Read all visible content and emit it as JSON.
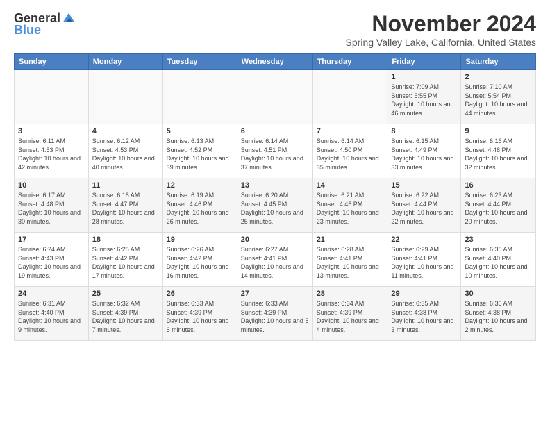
{
  "logo": {
    "general": "General",
    "blue": "Blue"
  },
  "title": "November 2024",
  "location": "Spring Valley Lake, California, United States",
  "days_header": [
    "Sunday",
    "Monday",
    "Tuesday",
    "Wednesday",
    "Thursday",
    "Friday",
    "Saturday"
  ],
  "weeks": [
    [
      {
        "day": "",
        "info": ""
      },
      {
        "day": "",
        "info": ""
      },
      {
        "day": "",
        "info": ""
      },
      {
        "day": "",
        "info": ""
      },
      {
        "day": "",
        "info": ""
      },
      {
        "day": "1",
        "info": "Sunrise: 7:09 AM\nSunset: 5:55 PM\nDaylight: 10 hours and 46 minutes."
      },
      {
        "day": "2",
        "info": "Sunrise: 7:10 AM\nSunset: 5:54 PM\nDaylight: 10 hours and 44 minutes."
      }
    ],
    [
      {
        "day": "3",
        "info": "Sunrise: 6:11 AM\nSunset: 4:53 PM\nDaylight: 10 hours and 42 minutes."
      },
      {
        "day": "4",
        "info": "Sunrise: 6:12 AM\nSunset: 4:53 PM\nDaylight: 10 hours and 40 minutes."
      },
      {
        "day": "5",
        "info": "Sunrise: 6:13 AM\nSunset: 4:52 PM\nDaylight: 10 hours and 39 minutes."
      },
      {
        "day": "6",
        "info": "Sunrise: 6:14 AM\nSunset: 4:51 PM\nDaylight: 10 hours and 37 minutes."
      },
      {
        "day": "7",
        "info": "Sunrise: 6:14 AM\nSunset: 4:50 PM\nDaylight: 10 hours and 35 minutes."
      },
      {
        "day": "8",
        "info": "Sunrise: 6:15 AM\nSunset: 4:49 PM\nDaylight: 10 hours and 33 minutes."
      },
      {
        "day": "9",
        "info": "Sunrise: 6:16 AM\nSunset: 4:48 PM\nDaylight: 10 hours and 32 minutes."
      }
    ],
    [
      {
        "day": "10",
        "info": "Sunrise: 6:17 AM\nSunset: 4:48 PM\nDaylight: 10 hours and 30 minutes."
      },
      {
        "day": "11",
        "info": "Sunrise: 6:18 AM\nSunset: 4:47 PM\nDaylight: 10 hours and 28 minutes."
      },
      {
        "day": "12",
        "info": "Sunrise: 6:19 AM\nSunset: 4:46 PM\nDaylight: 10 hours and 26 minutes."
      },
      {
        "day": "13",
        "info": "Sunrise: 6:20 AM\nSunset: 4:45 PM\nDaylight: 10 hours and 25 minutes."
      },
      {
        "day": "14",
        "info": "Sunrise: 6:21 AM\nSunset: 4:45 PM\nDaylight: 10 hours and 23 minutes."
      },
      {
        "day": "15",
        "info": "Sunrise: 6:22 AM\nSunset: 4:44 PM\nDaylight: 10 hours and 22 minutes."
      },
      {
        "day": "16",
        "info": "Sunrise: 6:23 AM\nSunset: 4:44 PM\nDaylight: 10 hours and 20 minutes."
      }
    ],
    [
      {
        "day": "17",
        "info": "Sunrise: 6:24 AM\nSunset: 4:43 PM\nDaylight: 10 hours and 19 minutes."
      },
      {
        "day": "18",
        "info": "Sunrise: 6:25 AM\nSunset: 4:42 PM\nDaylight: 10 hours and 17 minutes."
      },
      {
        "day": "19",
        "info": "Sunrise: 6:26 AM\nSunset: 4:42 PM\nDaylight: 10 hours and 16 minutes."
      },
      {
        "day": "20",
        "info": "Sunrise: 6:27 AM\nSunset: 4:41 PM\nDaylight: 10 hours and 14 minutes."
      },
      {
        "day": "21",
        "info": "Sunrise: 6:28 AM\nSunset: 4:41 PM\nDaylight: 10 hours and 13 minutes."
      },
      {
        "day": "22",
        "info": "Sunrise: 6:29 AM\nSunset: 4:41 PM\nDaylight: 10 hours and 11 minutes."
      },
      {
        "day": "23",
        "info": "Sunrise: 6:30 AM\nSunset: 4:40 PM\nDaylight: 10 hours and 10 minutes."
      }
    ],
    [
      {
        "day": "24",
        "info": "Sunrise: 6:31 AM\nSunset: 4:40 PM\nDaylight: 10 hours and 9 minutes."
      },
      {
        "day": "25",
        "info": "Sunrise: 6:32 AM\nSunset: 4:39 PM\nDaylight: 10 hours and 7 minutes."
      },
      {
        "day": "26",
        "info": "Sunrise: 6:33 AM\nSunset: 4:39 PM\nDaylight: 10 hours and 6 minutes."
      },
      {
        "day": "27",
        "info": "Sunrise: 6:33 AM\nSunset: 4:39 PM\nDaylight: 10 hours and 5 minutes."
      },
      {
        "day": "28",
        "info": "Sunrise: 6:34 AM\nSunset: 4:39 PM\nDaylight: 10 hours and 4 minutes."
      },
      {
        "day": "29",
        "info": "Sunrise: 6:35 AM\nSunset: 4:38 PM\nDaylight: 10 hours and 3 minutes."
      },
      {
        "day": "30",
        "info": "Sunrise: 6:36 AM\nSunset: 4:38 PM\nDaylight: 10 hours and 2 minutes."
      }
    ]
  ]
}
